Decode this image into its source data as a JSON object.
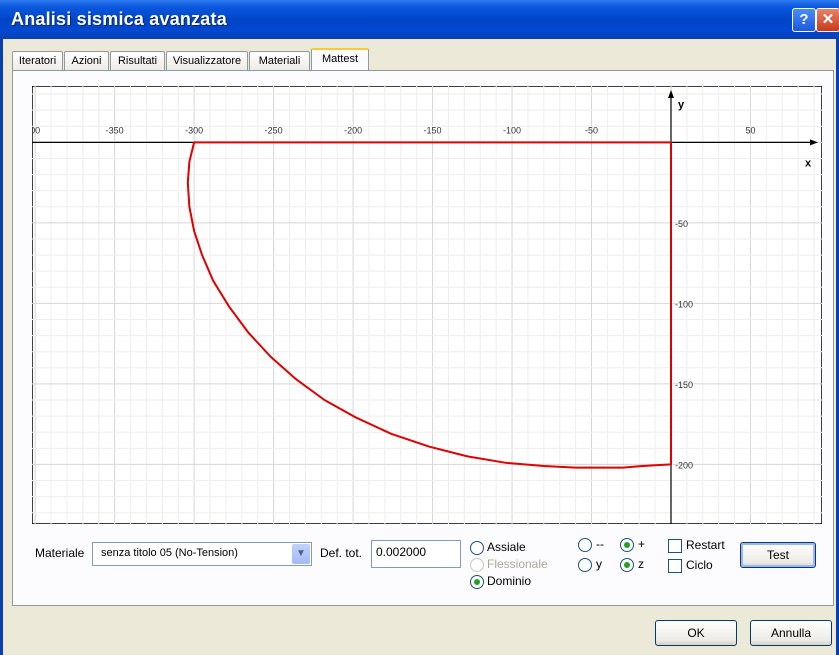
{
  "window": {
    "title": "Analisi sismica avanzata",
    "help_label": "?",
    "close_label": "✕"
  },
  "tabs": [
    {
      "label": "Iteratori"
    },
    {
      "label": "Azioni"
    },
    {
      "label": "Risultati"
    },
    {
      "label": "Visualizzatore"
    },
    {
      "label": "Materiali"
    },
    {
      "label": "Mattest"
    }
  ],
  "active_tab": "Mattest",
  "chart_data": {
    "type": "line",
    "x_axis_label": "x",
    "y_axis_label": "y",
    "x_tick_labels": [
      "00",
      "-350",
      "-300",
      "-250",
      "-200",
      "-150",
      "-100",
      "-50",
      "50"
    ],
    "x_ticks": [
      -400,
      -350,
      -300,
      -250,
      -200,
      -150,
      -100,
      -50,
      50
    ],
    "y_tick_labels": [
      "-50",
      "-100",
      "-150",
      "-200"
    ],
    "y_ticks": [
      -50,
      -100,
      -150,
      -200
    ],
    "xlim": [
      -402,
      95
    ],
    "ylim": [
      -237,
      35
    ],
    "grid": true,
    "series": [
      {
        "color": "#E00000",
        "x": [
          -300,
          -303,
          -304,
          -303,
          -300,
          -295,
          -288,
          -278,
          -266,
          -252,
          -236,
          -218,
          -198,
          -176,
          -152,
          -128,
          -104,
          -80,
          -60,
          -44,
          -30,
          -18,
          0,
          0,
          -300
        ],
        "y": [
          0,
          -12,
          -25,
          -40,
          -55,
          -70,
          -86,
          -102,
          -118,
          -133,
          -147,
          -160,
          -171,
          -181,
          -189,
          -195,
          -199,
          -201,
          -202,
          -202,
          -202,
          -201,
          -200,
          0,
          0
        ]
      }
    ]
  },
  "controls": {
    "material_label": "Materiale",
    "material_value": "senza titolo 05 (No-Tension)",
    "def_tot_label": "Def. tot.",
    "def_tot_value": "0.002000",
    "mode_options": [
      {
        "label": "Assiale",
        "selected": false,
        "disabled": false
      },
      {
        "label": "Flessionale",
        "selected": false,
        "disabled": true
      },
      {
        "label": "Dominio",
        "selected": true,
        "disabled": false
      }
    ],
    "sign_options": [
      {
        "label": "--",
        "selected": false
      },
      {
        "label": "+",
        "selected": true
      }
    ],
    "axis_options": [
      {
        "label": "y",
        "selected": false
      },
      {
        "label": "z",
        "selected": true
      }
    ],
    "restart_label": "Restart",
    "restart_checked": false,
    "ciclo_label": "Ciclo",
    "ciclo_checked": false,
    "test_label": "Test"
  },
  "footer": {
    "ok_label": "OK",
    "cancel_label": "Annulla"
  }
}
